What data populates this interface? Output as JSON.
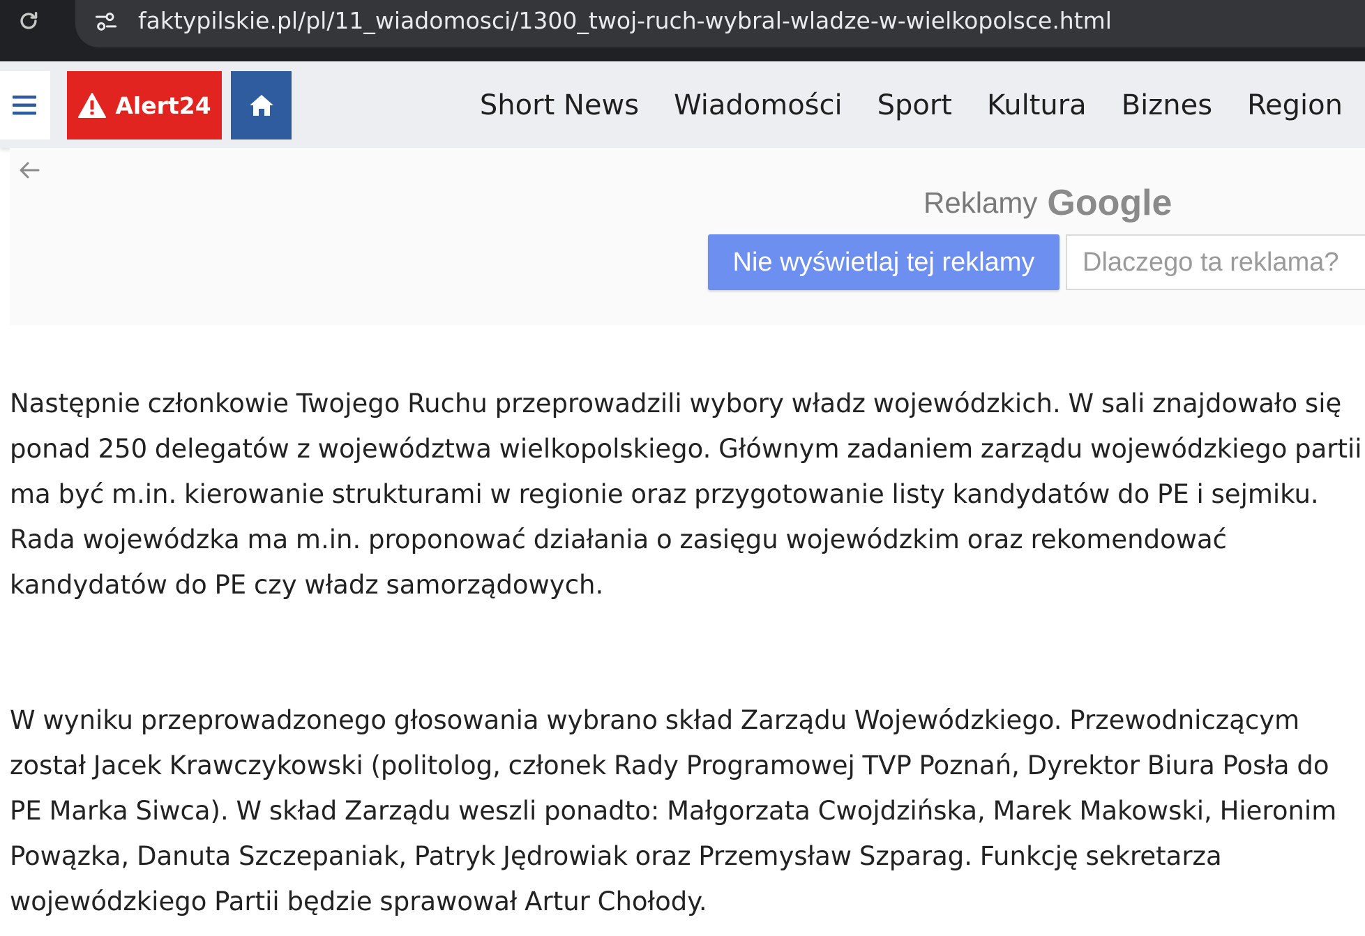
{
  "browser": {
    "url": "faktypilskie.pl/pl/11_wiadomosci/1300_twoj-ruch-wybral-wladze-w-wielkopolsce.html",
    "icons": [
      "reload-icon",
      "site-settings-icon"
    ]
  },
  "nav": {
    "alert_label": "Alert24",
    "links": [
      "Short News",
      "Wiadomości",
      "Sport",
      "Kultura",
      "Biznes",
      "Region"
    ],
    "colors": {
      "alert": "#e1241f",
      "home": "#2f5c9e",
      "bar": "#eceef1"
    }
  },
  "ad": {
    "label": "Reklamy",
    "brand": "Google",
    "stop_button": "Nie wyświetlaj tej reklamy",
    "why_button": "Dlaczego ta reklama?",
    "colors": {
      "stop_button": "#6d8ff0"
    }
  },
  "article": {
    "paragraphs": [
      "Następnie członkowie Twojego Ruchu przeprowadzili wybory władz wojewódzkich. W sali znajdowało się ponad 250 delegatów z  województwa wielkopolskiego. Głównym zadaniem zarządu wojewódzkiego partii ma być m.in. kierowanie strukturami w regionie oraz przygotowanie listy kandydatów do PE i sejmiku. Rada wojewódzka ma m.in. proponować działania o zasięgu wojewódzkim oraz rekomendować kandydatów do PE czy władz samorządowych.",
      "W wyniku przeprowadzonego głosowania wybrano skład Zarządu Wojewódzkiego. Przewodniczącym został Jacek Krawczykowski (politolog, członek Rady Programowej TVP Poznań, Dyrektor Biura Posła do PE  Marka Siwca). W skład Zarządu weszli ponadto: Małgorzata Cwojdzińska, Marek Makowski, Hieronim Powązka, Danuta Szczepaniak, Patryk Jędrowiak oraz Przemysław Szparag. Funkcję sekretarza wojewódzkiego Partii będzie sprawował Artur Chołody."
    ]
  }
}
